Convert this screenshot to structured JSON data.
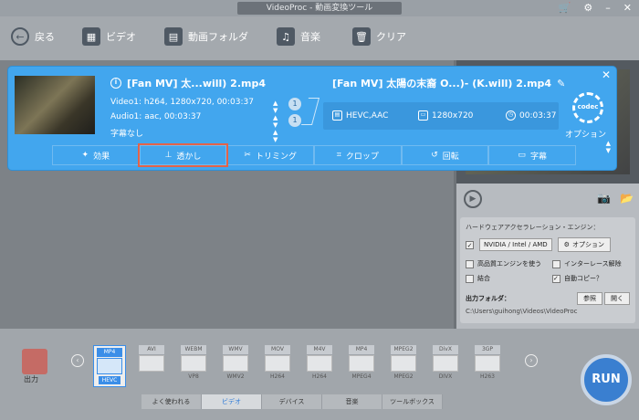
{
  "window": {
    "title": "VideoProc - 動画変換ツール"
  },
  "toolbar": {
    "back": "戻る",
    "video": "ビデオ",
    "folder": "動画フォルダ",
    "music": "音楽",
    "clear": "クリア"
  },
  "task": {
    "source_title": "[Fan MV] 太...will) 2.mp4",
    "video_line": "Video1: h264, 1280x720, 00:03:37",
    "audio_line": "Audio1: aac, 00:03:37",
    "subtitle_line": "字幕なし",
    "video_track_count": "1",
    "audio_track_count": "1",
    "output_title": "[Fan MV] 太陽の末裔 O...)- (K.will) 2.mp4",
    "out_codec": "HEVC,AAC",
    "out_resolution": "1280x720",
    "out_duration": "00:03:37",
    "codec_badge": "codec",
    "option_label": "オプション"
  },
  "edit_bar": {
    "effect": "効果",
    "watermark": "透かし",
    "trim": "トリミング",
    "crop": "クロップ",
    "rotate": "回転",
    "subtitle": "字幕"
  },
  "hw": {
    "title": "ハードウェアアクセラレーション・エンジン：",
    "engine": "NVIDIA / Intel / AMD",
    "option_btn": "オプション",
    "hq_engine": "高品質エンジンを使う",
    "deinterlace": "インターレース解除",
    "merge": "結合",
    "autocopy": "自動コピー？",
    "output_label": "出力フォルダ：",
    "browse": "参照",
    "open": "開く",
    "output_path": "C:\\Users\\guihong\\Videos\\VideoProc"
  },
  "bottom": {
    "output_label": "出力",
    "formats": [
      {
        "tag": "MP4",
        "sub": "HEVC"
      },
      {
        "tag": "AVI",
        "sub": ""
      },
      {
        "tag": "WEBM",
        "sub": "VP8"
      },
      {
        "tag": "WMV",
        "sub": "WMV2"
      },
      {
        "tag": "MOV",
        "sub": "H264"
      },
      {
        "tag": "M4V",
        "sub": "H264"
      },
      {
        "tag": "MP4",
        "sub": "MPEG4"
      },
      {
        "tag": "MPEG2",
        "sub": "MPEG2"
      },
      {
        "tag": "DivX",
        "sub": "DIVX"
      },
      {
        "tag": "3GP",
        "sub": "H263"
      }
    ],
    "run": "RUN",
    "tabs": [
      "よく使われる",
      "ビデオ",
      "デバイス",
      "音楽",
      "ツールボックス"
    ]
  },
  "colors": {
    "card": "#42a6ee",
    "highlight": "#e2634a",
    "run": "#3a7fd0"
  }
}
